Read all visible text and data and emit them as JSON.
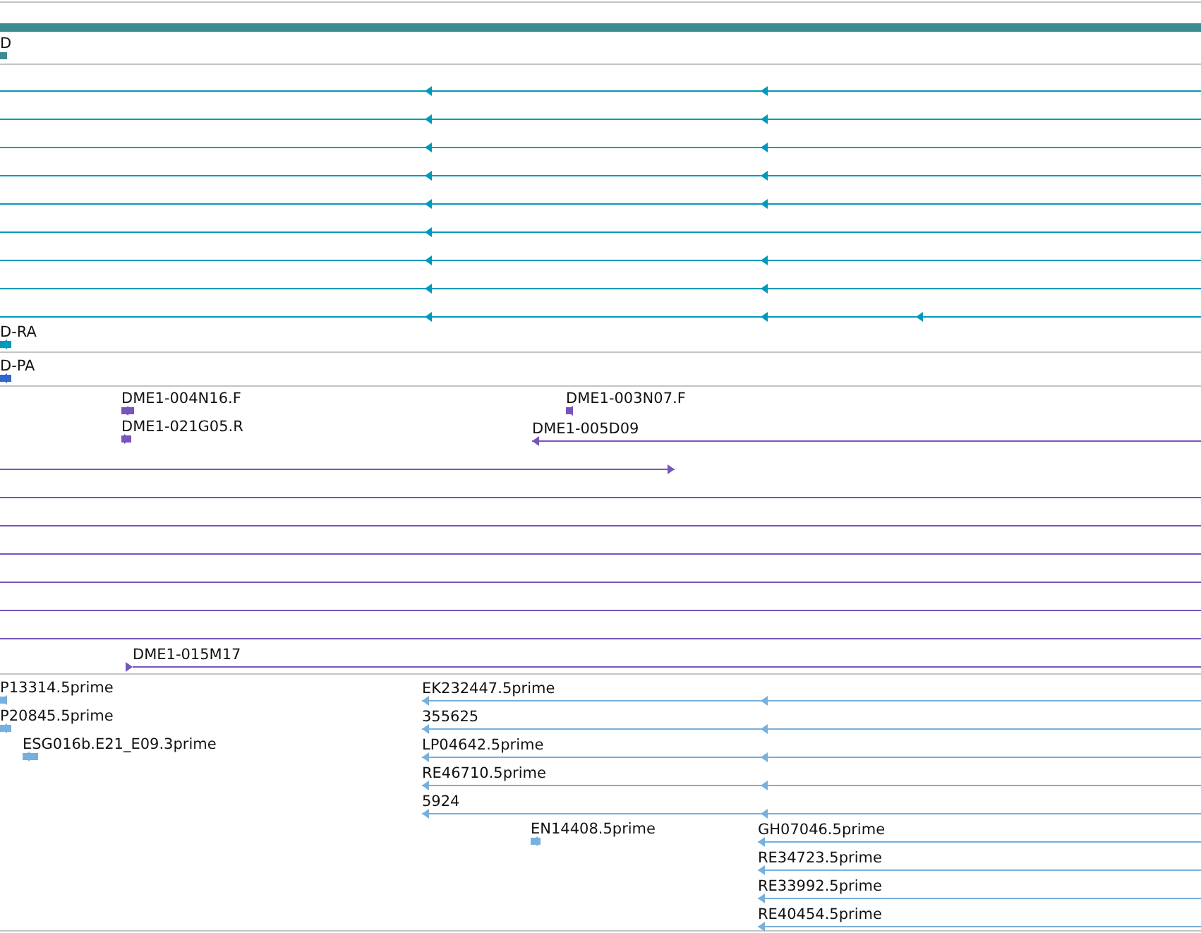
{
  "tracks": [
    {
      "color": "#3a8c90",
      "features": [
        {
          "kind": "bar"
        },
        {
          "kind": "block",
          "label": "D"
        }
      ]
    },
    {
      "color": "#0099bb",
      "features": [
        {
          "kind": "line",
          "reverse": true
        },
        {
          "kind": "line",
          "reverse": true
        },
        {
          "kind": "line",
          "reverse": true
        },
        {
          "kind": "line",
          "reverse": true
        },
        {
          "kind": "line",
          "reverse": true
        },
        {
          "kind": "line",
          "reverse": true
        },
        {
          "kind": "line",
          "reverse": true
        },
        {
          "kind": "line",
          "reverse": true
        },
        {
          "kind": "line",
          "reverse": true
        },
        {
          "kind": "block",
          "reverse": true,
          "label": "D-RA"
        }
      ]
    },
    {
      "color": "#3366cc",
      "features": [
        {
          "kind": "block",
          "reverse": true,
          "label": "D-PA"
        }
      ]
    },
    {
      "color": "#7755bb",
      "features": [
        {
          "kind": "block",
          "reverse": true,
          "label": "DME1-004N16.F"
        },
        {
          "kind": "block",
          "reverse": true,
          "label": "DME1-003N07.F"
        },
        {
          "kind": "block",
          "reverse": false,
          "label": "DME1-021G05.R"
        },
        {
          "kind": "line",
          "reverse": true,
          "label": "DME1-005D09"
        },
        {
          "kind": "line",
          "reverse": false
        },
        {
          "kind": "line"
        },
        {
          "kind": "line"
        },
        {
          "kind": "line"
        },
        {
          "kind": "line"
        },
        {
          "kind": "line"
        },
        {
          "kind": "line"
        },
        {
          "kind": "line",
          "reverse": false,
          "label": "DME1-015M17"
        }
      ]
    },
    {
      "color": "#77b0dd",
      "features": [
        {
          "kind": "block",
          "reverse": true,
          "label": "P13314.5prime"
        },
        {
          "kind": "block",
          "reverse": true,
          "label": "P20845.5prime"
        },
        {
          "kind": "block",
          "reverse": true,
          "label": "ESG016b.E21_E09.3prime"
        },
        {
          "kind": "line",
          "reverse": true,
          "label": "EK232447.5prime"
        },
        {
          "kind": "line",
          "reverse": true,
          "label": "355625"
        },
        {
          "kind": "line",
          "reverse": true,
          "label": "LP04642.5prime"
        },
        {
          "kind": "line",
          "reverse": true,
          "label": "RE46710.5prime"
        },
        {
          "kind": "line",
          "reverse": true,
          "label": "5924"
        },
        {
          "kind": "block",
          "reverse": true,
          "label": "EN14408.5prime"
        },
        {
          "kind": "line",
          "reverse": true,
          "label": "GH07046.5prime"
        },
        {
          "kind": "line",
          "reverse": true,
          "label": "RE34723.5prime"
        },
        {
          "kind": "line",
          "reverse": true,
          "label": "RE33992.5prime"
        },
        {
          "kind": "line",
          "reverse": true,
          "label": "RE40454.5prime"
        }
      ]
    }
  ]
}
